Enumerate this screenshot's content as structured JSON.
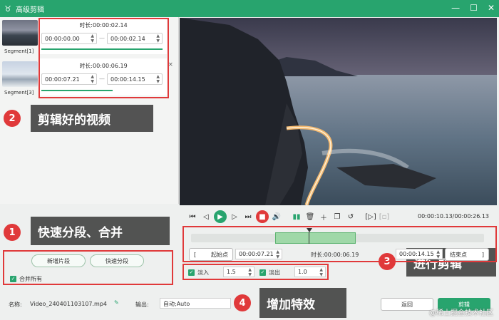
{
  "window": {
    "title": "高级剪辑",
    "minimize": "—",
    "maximize": "☐",
    "close": "✕"
  },
  "segments": [
    {
      "label": "Segment[1]",
      "duration_label": "时长:",
      "duration": "00:00:02.14",
      "start": "00:00:00.00",
      "end": "00:00:02.14"
    },
    {
      "label": "Segment[3]",
      "duration_label": "时长:",
      "duration": "00:00:06.19",
      "start": "00:00:07.21",
      "end": "00:00:14.15"
    }
  ],
  "segment_close": "✕",
  "left_actions": {
    "new_segment": "新增片段",
    "quick_split": "快速分段",
    "merge_all": "合并所有"
  },
  "footer": {
    "name_label": "名称:",
    "filename": "Video_240401103107.mp4",
    "output_label": "输出:",
    "output_value": "自动;Auto",
    "back": "返回",
    "cut": "剪辑"
  },
  "player": {
    "time_readout": "00:00:10.13/00:00:26.13"
  },
  "trim": {
    "start_btn": "起始点",
    "start_time": "00:00:07.21",
    "duration_label": "时长:",
    "duration": "00:00:06.19",
    "end_time": "00:00:14.15",
    "end_btn": "结束点",
    "bracket_l": "[",
    "bracket_r": "]"
  },
  "effects": {
    "fade_in_label": "淡入",
    "fade_in_value": "1.5",
    "fade_out_label": "淡出",
    "fade_out_value": "1.0"
  },
  "annotations": [
    {
      "num": "1",
      "text": "快速分段、合并"
    },
    {
      "num": "2",
      "text": "剪辑好的视频"
    },
    {
      "num": "3",
      "text": "进行剪辑"
    },
    {
      "num": "4",
      "text": "增加特效"
    }
  ],
  "watermark": "@稀土掘金技术社区",
  "colors": {
    "accent": "#28a46e",
    "annotation_red": "#e0393a"
  }
}
